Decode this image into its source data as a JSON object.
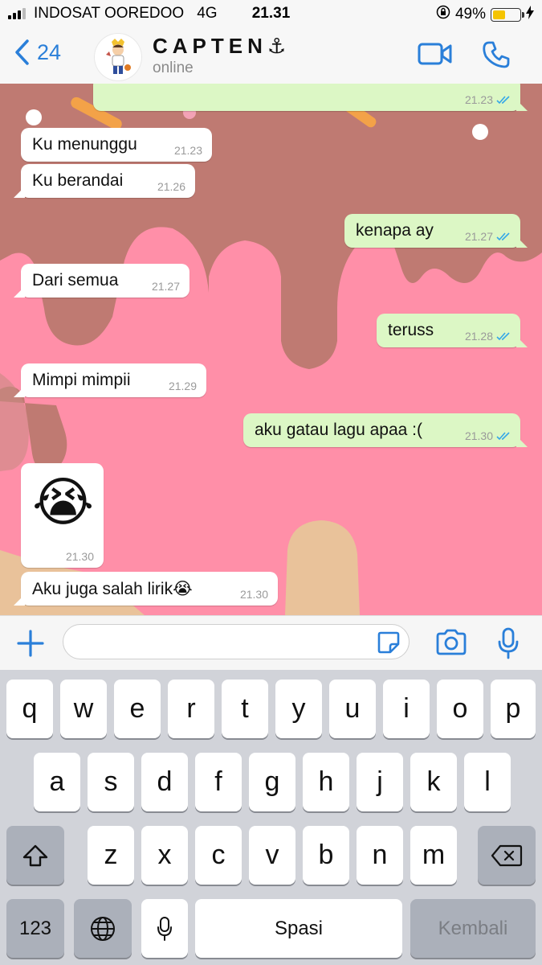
{
  "status_bar": {
    "carrier": "INDOSAT OOREDOO",
    "network": "4G",
    "time": "21.31",
    "battery": "49%",
    "battery_level": 0.49
  },
  "header": {
    "back_count": "24",
    "contact_name": "CAPTEN⚓",
    "contact_status": "online"
  },
  "messages": [
    {
      "dir": "out",
      "text": "",
      "time": "21.23",
      "read": true
    },
    {
      "dir": "in",
      "text": "Ku menunggu",
      "time": "21.23"
    },
    {
      "dir": "in",
      "text": "Ku berandai",
      "time": "21.26"
    },
    {
      "dir": "out",
      "text": "kenapa ay",
      "time": "21.27",
      "read": true
    },
    {
      "dir": "in",
      "text": "Dari semua",
      "time": "21.27"
    },
    {
      "dir": "out",
      "text": "teruss",
      "time": "21.28",
      "read": true
    },
    {
      "dir": "in",
      "text": "Mimpi mimpii",
      "time": "21.29"
    },
    {
      "dir": "out",
      "text": "aku gatau lagu apaa :(",
      "time": "21.30",
      "read": true
    },
    {
      "dir": "in",
      "text": "😭",
      "time": "21.30",
      "kind": "emoji"
    },
    {
      "dir": "in",
      "text": "Aku juga salah lirik😭",
      "time": "21.30"
    }
  ],
  "input": {
    "placeholder": ""
  },
  "keyboard": {
    "row1": [
      "q",
      "w",
      "e",
      "r",
      "t",
      "y",
      "u",
      "i",
      "o",
      "p"
    ],
    "row2": [
      "a",
      "s",
      "d",
      "f",
      "g",
      "h",
      "j",
      "k",
      "l"
    ],
    "row3": [
      "z",
      "x",
      "c",
      "v",
      "b",
      "n",
      "m"
    ],
    "numbers_label": "123",
    "space_label": "Spasi",
    "return_label": "Kembali"
  },
  "colors": {
    "accent": "#2a7fd9",
    "outgoing_bubble": "#dcf7c5",
    "incoming_bubble": "#ffffff",
    "wallpaper_pink": "#ff8fa8",
    "wallpaper_chocolate": "#bf7a72"
  }
}
